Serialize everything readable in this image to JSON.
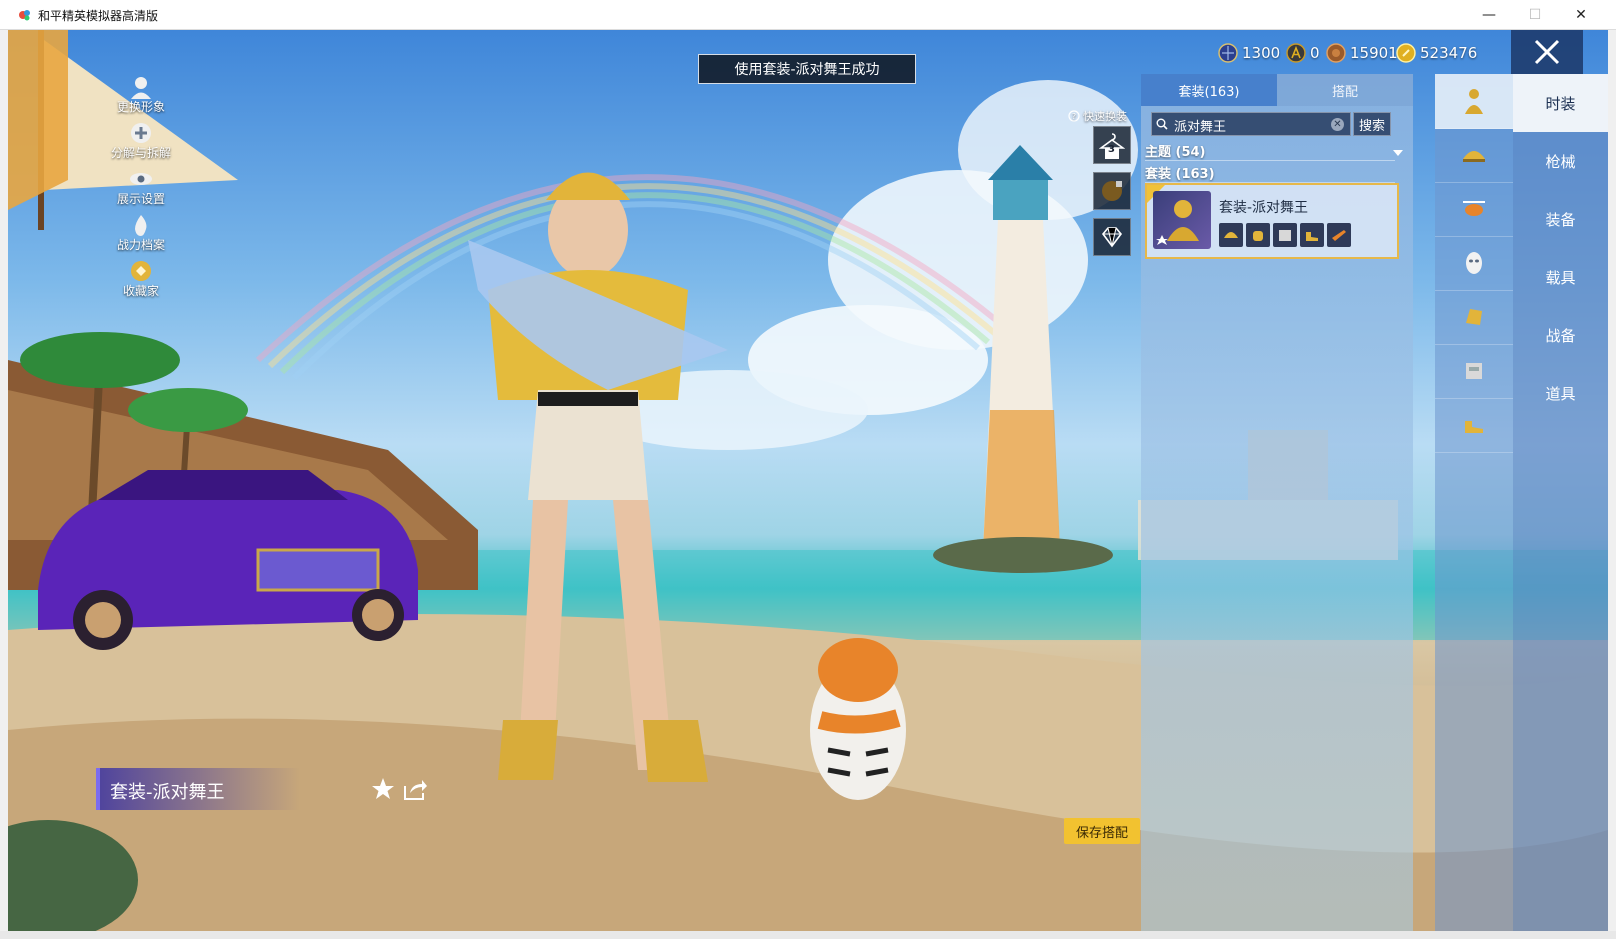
{
  "window": {
    "title": "和平精英模拟器高清版",
    "minimize_glyph": "—",
    "maximize_glyph": "☐",
    "close_glyph": "✕"
  },
  "left_menu": [
    {
      "label": "更换形象",
      "icon": "person-icon"
    },
    {
      "label": "分解与拆解",
      "icon": "gear-plus-icon"
    },
    {
      "label": "展示设置",
      "icon": "eye-icon"
    },
    {
      "label": "战力档案",
      "icon": "fire-icon"
    },
    {
      "label": "收藏家",
      "icon": "collector-badge-icon"
    }
  ],
  "toast": "使用套装-派对舞王成功",
  "currencies": [
    {
      "icon": "globe-coin-icon",
      "value": "1300",
      "color": "#2b3f8f"
    },
    {
      "icon": "a-coin-icon",
      "value": "0",
      "color": "#c89a2a"
    },
    {
      "icon": "bronze-coin-icon",
      "value": "15901",
      "color": "#9a5a2a"
    },
    {
      "icon": "gold-coin-icon",
      "value": "523476",
      "color": "#e0b020"
    }
  ],
  "quick_change": {
    "label": "快速换装",
    "slot_count": "3"
  },
  "panel": {
    "tabs": [
      {
        "label": "套装(163)",
        "active": true
      },
      {
        "label": "搭配",
        "active": false
      }
    ],
    "search": {
      "value": "派对舞王",
      "button": "搜索"
    },
    "categories": [
      {
        "label": "主题 (54)"
      },
      {
        "label": "套装 (163)"
      }
    ],
    "suit": {
      "name": "套装-派对舞王",
      "pieces": [
        "helmet-icon",
        "glove-icon",
        "backpack-icon",
        "shoe-icon",
        "rifle-icon"
      ]
    }
  },
  "icon_column": [
    {
      "icon": "outfit-icon",
      "active": true
    },
    {
      "icon": "helmet-icon",
      "active": false
    },
    {
      "icon": "helicopter-icon",
      "active": false
    },
    {
      "icon": "mask-icon",
      "active": false
    },
    {
      "icon": "glove-icon",
      "active": false
    },
    {
      "icon": "backpack-icon",
      "active": false
    },
    {
      "icon": "shoe-icon",
      "active": false
    }
  ],
  "category_column": [
    {
      "label": "时装",
      "active": true
    },
    {
      "label": "枪械",
      "active": false
    },
    {
      "label": "装备",
      "active": false
    },
    {
      "label": "载具",
      "active": false
    },
    {
      "label": "战备",
      "active": false
    },
    {
      "label": "道具",
      "active": false
    }
  ],
  "save_button": "保存搭配",
  "current_outfit_name": "套装-派对舞王",
  "colors": {
    "accent_gold": "#f2c230",
    "panel_blue": "#3c78c8",
    "name_plate": "#463ca0"
  }
}
